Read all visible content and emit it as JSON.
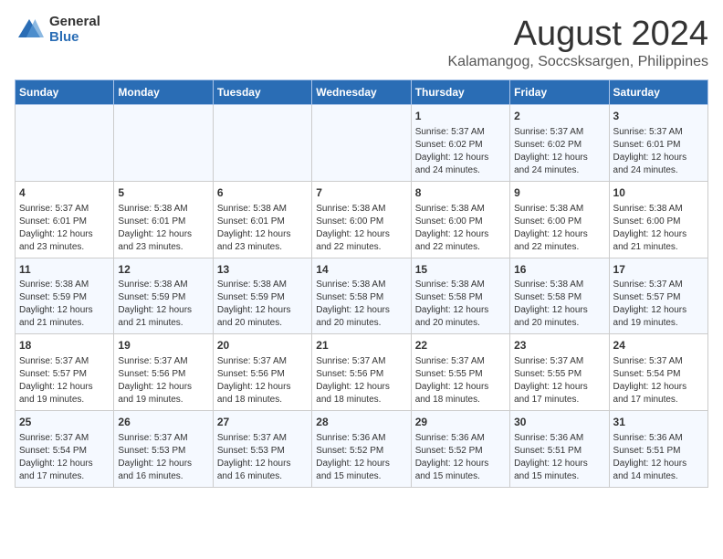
{
  "header": {
    "logo_general": "General",
    "logo_blue": "Blue",
    "month_year": "August 2024",
    "location": "Kalamangog, Soccsksargen, Philippines"
  },
  "weekdays": [
    "Sunday",
    "Monday",
    "Tuesday",
    "Wednesday",
    "Thursday",
    "Friday",
    "Saturday"
  ],
  "weeks": [
    [
      {
        "day": "",
        "info": ""
      },
      {
        "day": "",
        "info": ""
      },
      {
        "day": "",
        "info": ""
      },
      {
        "day": "",
        "info": ""
      },
      {
        "day": "1",
        "info": "Sunrise: 5:37 AM\nSunset: 6:02 PM\nDaylight: 12 hours\nand 24 minutes."
      },
      {
        "day": "2",
        "info": "Sunrise: 5:37 AM\nSunset: 6:02 PM\nDaylight: 12 hours\nand 24 minutes."
      },
      {
        "day": "3",
        "info": "Sunrise: 5:37 AM\nSunset: 6:01 PM\nDaylight: 12 hours\nand 24 minutes."
      }
    ],
    [
      {
        "day": "4",
        "info": "Sunrise: 5:37 AM\nSunset: 6:01 PM\nDaylight: 12 hours\nand 23 minutes."
      },
      {
        "day": "5",
        "info": "Sunrise: 5:38 AM\nSunset: 6:01 PM\nDaylight: 12 hours\nand 23 minutes."
      },
      {
        "day": "6",
        "info": "Sunrise: 5:38 AM\nSunset: 6:01 PM\nDaylight: 12 hours\nand 23 minutes."
      },
      {
        "day": "7",
        "info": "Sunrise: 5:38 AM\nSunset: 6:00 PM\nDaylight: 12 hours\nand 22 minutes."
      },
      {
        "day": "8",
        "info": "Sunrise: 5:38 AM\nSunset: 6:00 PM\nDaylight: 12 hours\nand 22 minutes."
      },
      {
        "day": "9",
        "info": "Sunrise: 5:38 AM\nSunset: 6:00 PM\nDaylight: 12 hours\nand 22 minutes."
      },
      {
        "day": "10",
        "info": "Sunrise: 5:38 AM\nSunset: 6:00 PM\nDaylight: 12 hours\nand 21 minutes."
      }
    ],
    [
      {
        "day": "11",
        "info": "Sunrise: 5:38 AM\nSunset: 5:59 PM\nDaylight: 12 hours\nand 21 minutes."
      },
      {
        "day": "12",
        "info": "Sunrise: 5:38 AM\nSunset: 5:59 PM\nDaylight: 12 hours\nand 21 minutes."
      },
      {
        "day": "13",
        "info": "Sunrise: 5:38 AM\nSunset: 5:59 PM\nDaylight: 12 hours\nand 20 minutes."
      },
      {
        "day": "14",
        "info": "Sunrise: 5:38 AM\nSunset: 5:58 PM\nDaylight: 12 hours\nand 20 minutes."
      },
      {
        "day": "15",
        "info": "Sunrise: 5:38 AM\nSunset: 5:58 PM\nDaylight: 12 hours\nand 20 minutes."
      },
      {
        "day": "16",
        "info": "Sunrise: 5:38 AM\nSunset: 5:58 PM\nDaylight: 12 hours\nand 20 minutes."
      },
      {
        "day": "17",
        "info": "Sunrise: 5:37 AM\nSunset: 5:57 PM\nDaylight: 12 hours\nand 19 minutes."
      }
    ],
    [
      {
        "day": "18",
        "info": "Sunrise: 5:37 AM\nSunset: 5:57 PM\nDaylight: 12 hours\nand 19 minutes."
      },
      {
        "day": "19",
        "info": "Sunrise: 5:37 AM\nSunset: 5:56 PM\nDaylight: 12 hours\nand 19 minutes."
      },
      {
        "day": "20",
        "info": "Sunrise: 5:37 AM\nSunset: 5:56 PM\nDaylight: 12 hours\nand 18 minutes."
      },
      {
        "day": "21",
        "info": "Sunrise: 5:37 AM\nSunset: 5:56 PM\nDaylight: 12 hours\nand 18 minutes."
      },
      {
        "day": "22",
        "info": "Sunrise: 5:37 AM\nSunset: 5:55 PM\nDaylight: 12 hours\nand 18 minutes."
      },
      {
        "day": "23",
        "info": "Sunrise: 5:37 AM\nSunset: 5:55 PM\nDaylight: 12 hours\nand 17 minutes."
      },
      {
        "day": "24",
        "info": "Sunrise: 5:37 AM\nSunset: 5:54 PM\nDaylight: 12 hours\nand 17 minutes."
      }
    ],
    [
      {
        "day": "25",
        "info": "Sunrise: 5:37 AM\nSunset: 5:54 PM\nDaylight: 12 hours\nand 17 minutes."
      },
      {
        "day": "26",
        "info": "Sunrise: 5:37 AM\nSunset: 5:53 PM\nDaylight: 12 hours\nand 16 minutes."
      },
      {
        "day": "27",
        "info": "Sunrise: 5:37 AM\nSunset: 5:53 PM\nDaylight: 12 hours\nand 16 minutes."
      },
      {
        "day": "28",
        "info": "Sunrise: 5:36 AM\nSunset: 5:52 PM\nDaylight: 12 hours\nand 15 minutes."
      },
      {
        "day": "29",
        "info": "Sunrise: 5:36 AM\nSunset: 5:52 PM\nDaylight: 12 hours\nand 15 minutes."
      },
      {
        "day": "30",
        "info": "Sunrise: 5:36 AM\nSunset: 5:51 PM\nDaylight: 12 hours\nand 15 minutes."
      },
      {
        "day": "31",
        "info": "Sunrise: 5:36 AM\nSunset: 5:51 PM\nDaylight: 12 hours\nand 14 minutes."
      }
    ]
  ]
}
